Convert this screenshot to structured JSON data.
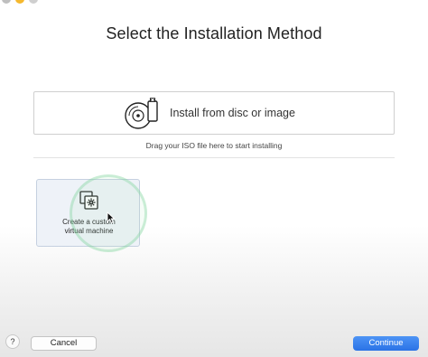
{
  "window": {
    "traffic_lights": [
      "close",
      "minimize",
      "zoom"
    ]
  },
  "title": "Select the Installation Method",
  "disc_option": {
    "label": "Install from disc or image",
    "icon": "disc-usb-icon"
  },
  "drag_hint": "Drag your ISO file here to start installing",
  "custom_option": {
    "label_line1": "Create a custom",
    "label_line2": "virtual machine",
    "icon": "custom-vm-icon"
  },
  "footer": {
    "help_label": "?",
    "cancel_label": "Cancel",
    "continue_label": "Continue"
  },
  "colors": {
    "accent": "#2f78e8",
    "selection_fill": "#eef2f8"
  }
}
